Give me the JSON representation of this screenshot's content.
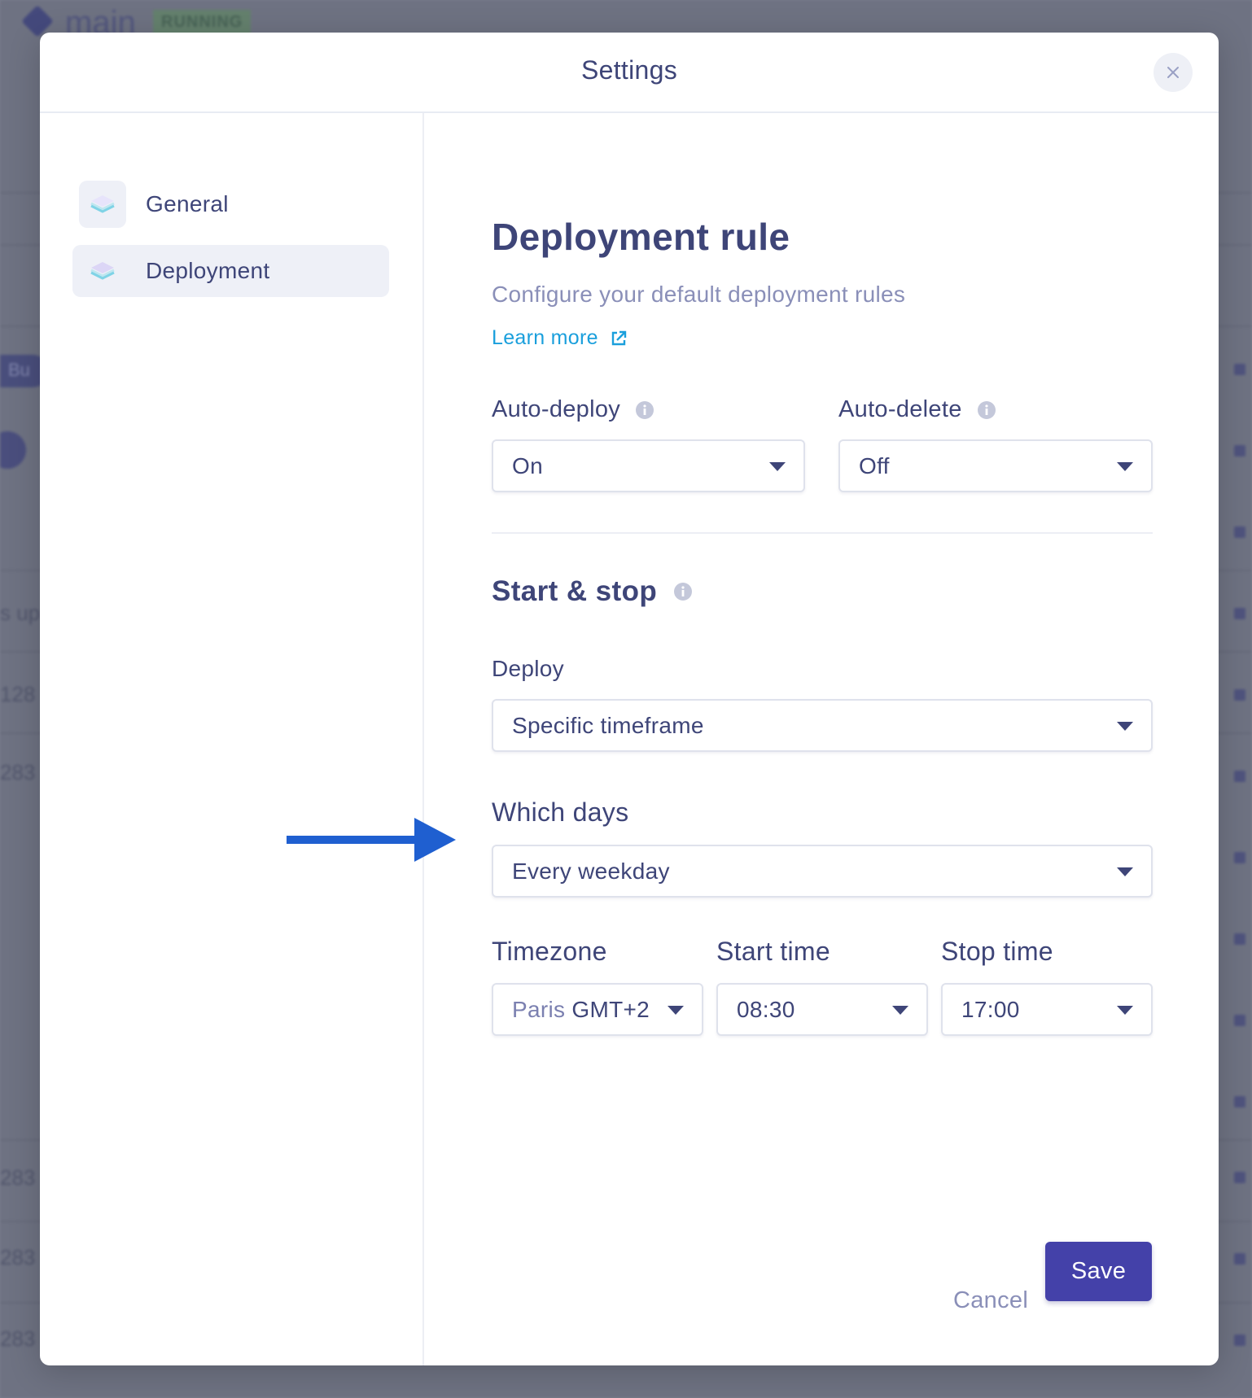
{
  "background": {
    "app_title": "main",
    "status_badge": "RUNNING",
    "pill_text": "Bu",
    "row_text_1": "s up",
    "row_numbers": [
      "128",
      "283",
      "283",
      "283",
      "283"
    ]
  },
  "modal": {
    "title": "Settings",
    "close_icon": "close-icon"
  },
  "sidebar": {
    "items": [
      {
        "label": "General",
        "icon": "layers-icon",
        "active": false
      },
      {
        "label": "Deployment",
        "icon": "layers-icon",
        "active": true
      }
    ]
  },
  "content": {
    "title": "Deployment rule",
    "subtitle": "Configure your default deployment rules",
    "learn_more": "Learn more",
    "auto_deploy": {
      "label": "Auto-deploy",
      "value": "On"
    },
    "auto_delete": {
      "label": "Auto-delete",
      "value": "Off"
    },
    "start_stop": {
      "title": "Start & stop"
    },
    "deploy": {
      "label": "Deploy",
      "value": "Specific timeframe"
    },
    "which_days": {
      "label": "Which days",
      "value": "Every weekday"
    },
    "timezone": {
      "label": "Timezone",
      "value_city": "Paris",
      "value_offset": "GMT+2"
    },
    "start_time": {
      "label": "Start time",
      "value": "08:30"
    },
    "stop_time": {
      "label": "Stop time",
      "value": "17:00"
    }
  },
  "footer": {
    "cancel_label": "Cancel",
    "save_label": "Save"
  },
  "colors": {
    "primary": "#4441a9",
    "text": "#3e4578",
    "link": "#1a9fdc",
    "annotation_arrow": "#1f5fd0"
  }
}
